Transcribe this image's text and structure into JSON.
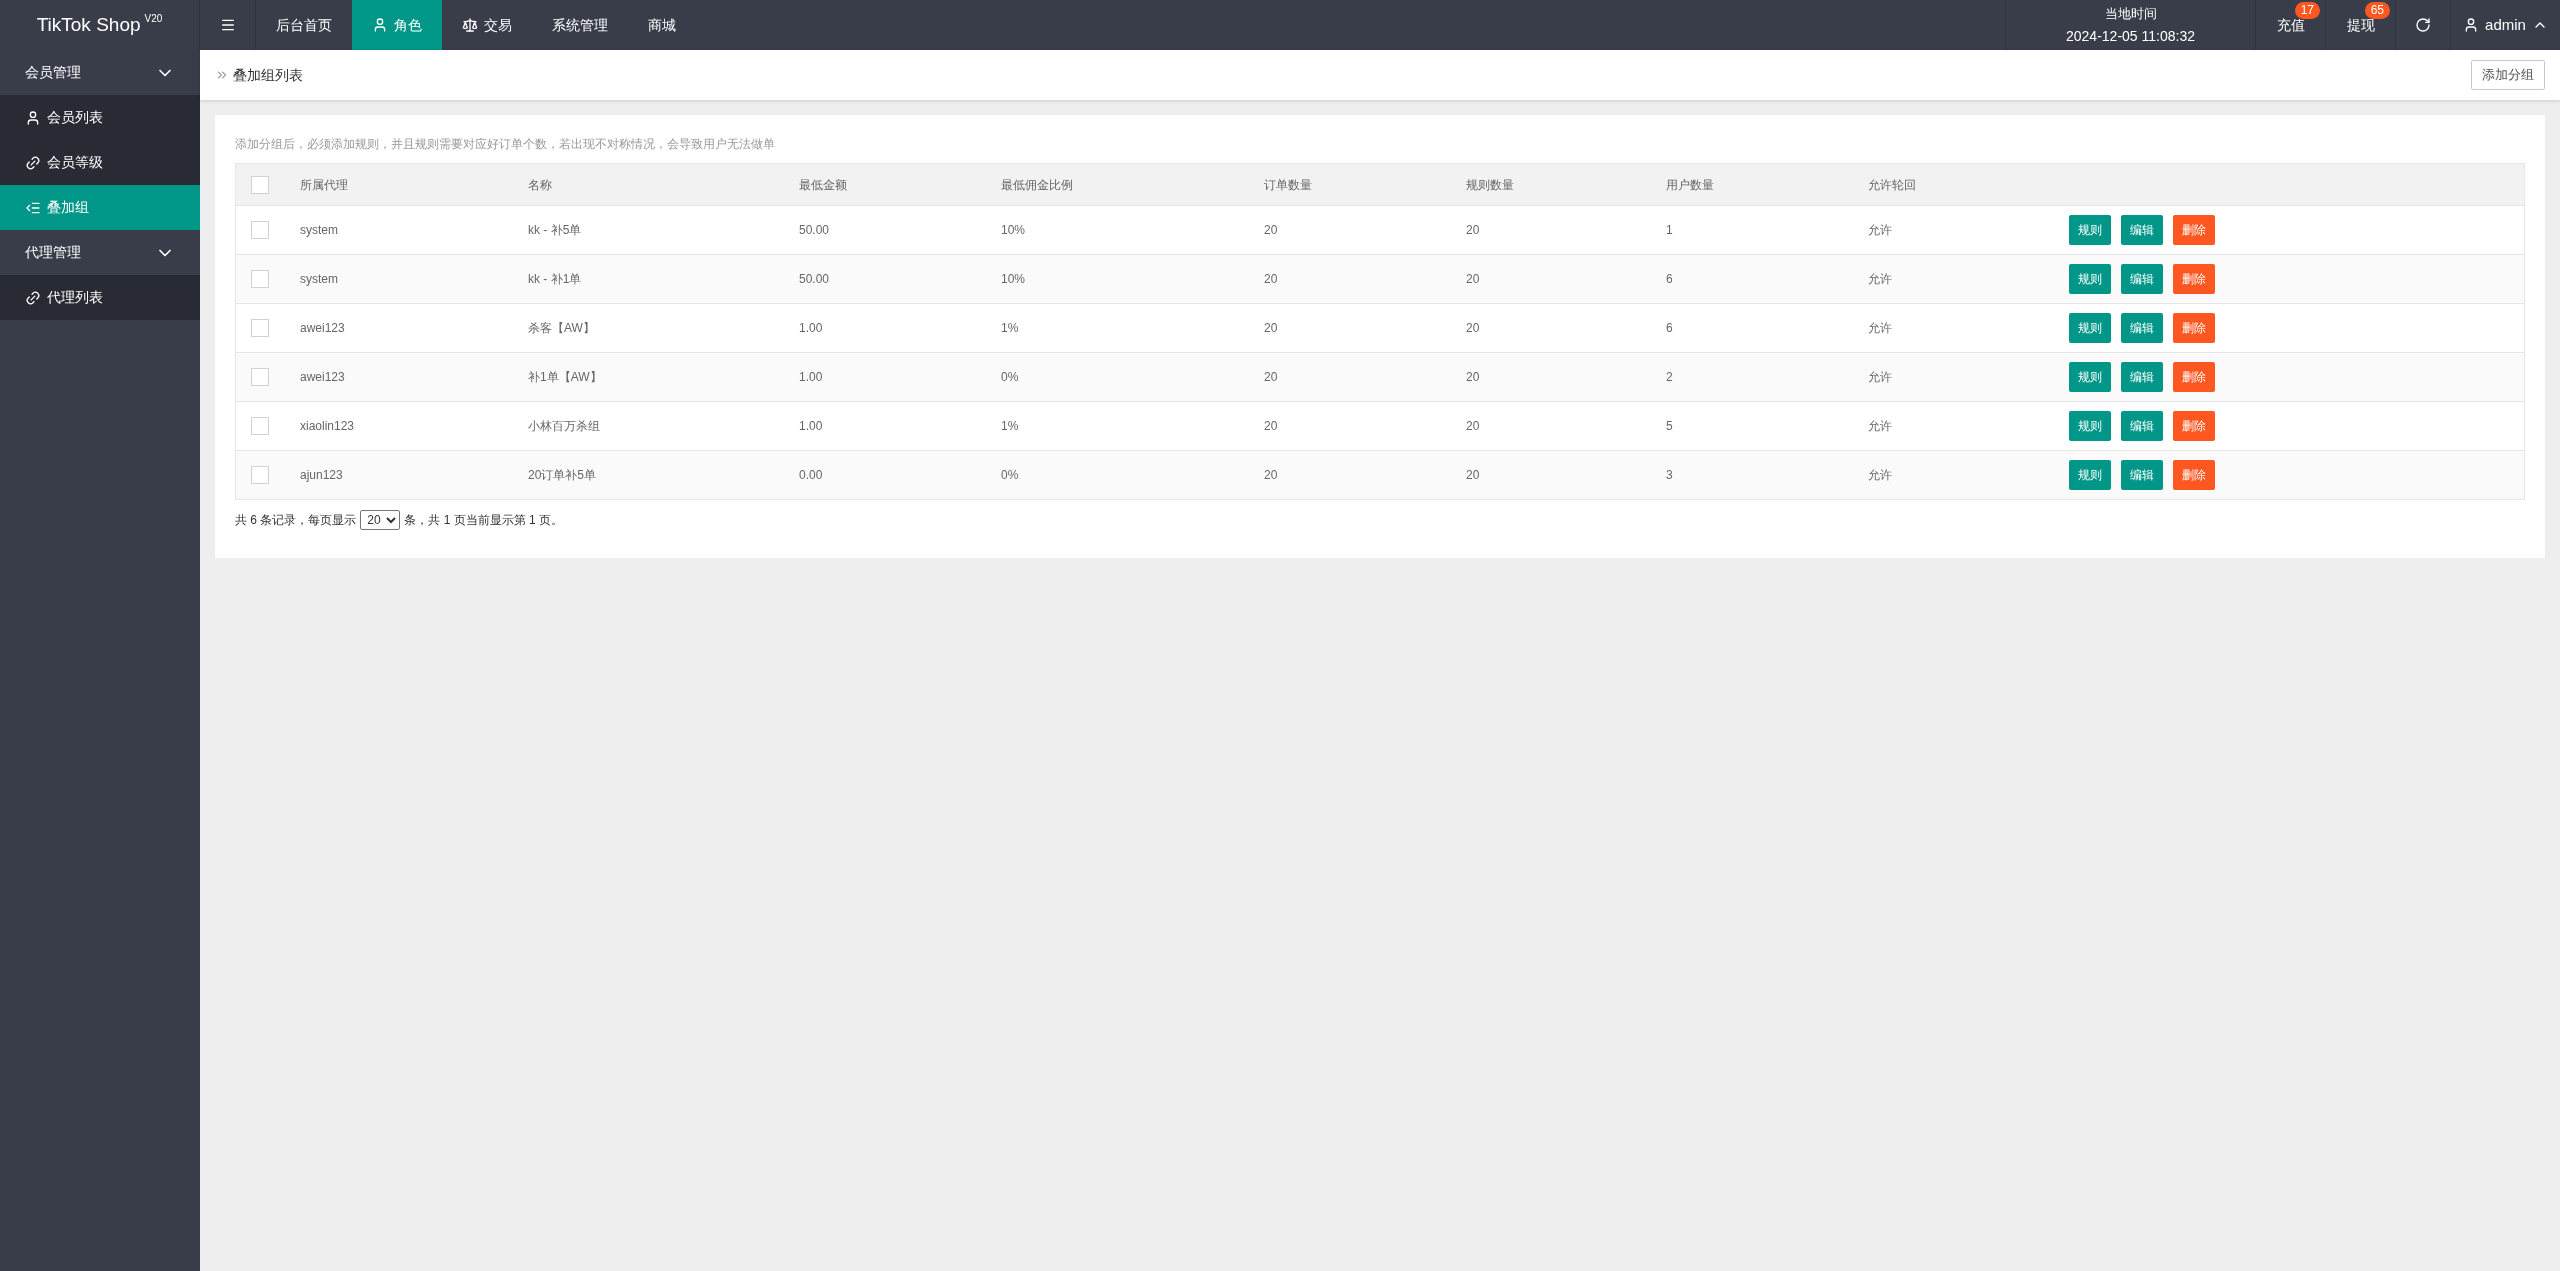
{
  "brand": {
    "name": "TikTok Shop",
    "version": "V20"
  },
  "top_nav": [
    {
      "label": "后台首页",
      "selected": false
    },
    {
      "label": "角色",
      "selected": true
    },
    {
      "label": "交易",
      "selected": false
    },
    {
      "label": "系统管理",
      "selected": false
    },
    {
      "label": "商城",
      "selected": false
    }
  ],
  "clock": {
    "label": "当地时间",
    "value": "2024-12-05 11:08:32"
  },
  "top_actions": [
    {
      "label": "充值",
      "badge": "17"
    },
    {
      "label": "提现",
      "badge": "65"
    }
  ],
  "user": {
    "name": "admin",
    "expanded": true
  },
  "sidebar": [
    {
      "label": "会员管理",
      "expanded": true,
      "children": [
        {
          "label": "会员列表",
          "selected": false
        },
        {
          "label": "会员等级",
          "selected": false
        },
        {
          "label": "叠加组",
          "selected": true
        }
      ]
    },
    {
      "label": "代理管理",
      "expanded": true,
      "children": [
        {
          "label": "代理列表",
          "selected": false
        }
      ]
    }
  ],
  "breadcrumb": "叠加组列表",
  "add_button": "添加分组",
  "notice": "添加分组后，必须添加规则，并且规则需要对应好订单个数，若出现不对称情况，会导致用户无法做单",
  "table": {
    "columns": [
      "所属代理",
      "名称",
      "最低金额",
      "最低佣金比例",
      "订单数量",
      "规则数量",
      "用户数量",
      "允许轮回"
    ],
    "header_checked": false,
    "rows": [
      {
        "checked": false,
        "cells": [
          "system",
          "kk - 补5单",
          "50.00",
          "10%",
          "20",
          "20",
          "1",
          "允许"
        ],
        "actions": [
          "规则",
          "编辑",
          "删除"
        ]
      },
      {
        "checked": false,
        "cells": [
          "system",
          "kk - 补1单",
          "50.00",
          "10%",
          "20",
          "20",
          "6",
          "允许"
        ],
        "actions": [
          "规则",
          "编辑",
          "删除"
        ]
      },
      {
        "checked": false,
        "cells": [
          "awei123",
          "杀客【AW】",
          "1.00",
          "1%",
          "20",
          "20",
          "6",
          "允许"
        ],
        "actions": [
          "规则",
          "编辑",
          "删除"
        ]
      },
      {
        "checked": false,
        "cells": [
          "awei123",
          "补1单【AW】",
          "1.00",
          "0%",
          "20",
          "20",
          "2",
          "允许"
        ],
        "actions": [
          "规则",
          "编辑",
          "删除"
        ]
      },
      {
        "checked": false,
        "cells": [
          "xiaolin123",
          "小林百万杀组",
          "1.00",
          "1%",
          "20",
          "20",
          "5",
          "允许"
        ],
        "actions": [
          "规则",
          "编辑",
          "删除"
        ]
      },
      {
        "checked": false,
        "cells": [
          "ajun123",
          "20订单补5单",
          "0.00",
          "0%",
          "20",
          "20",
          "3",
          "允许"
        ],
        "actions": [
          "规则",
          "编辑",
          "删除"
        ]
      }
    ]
  },
  "pagination": {
    "before": "共 6 条记录，每页显示",
    "page_size": "20",
    "after": "条，共 1 页当前显示第 1 页。"
  }
}
